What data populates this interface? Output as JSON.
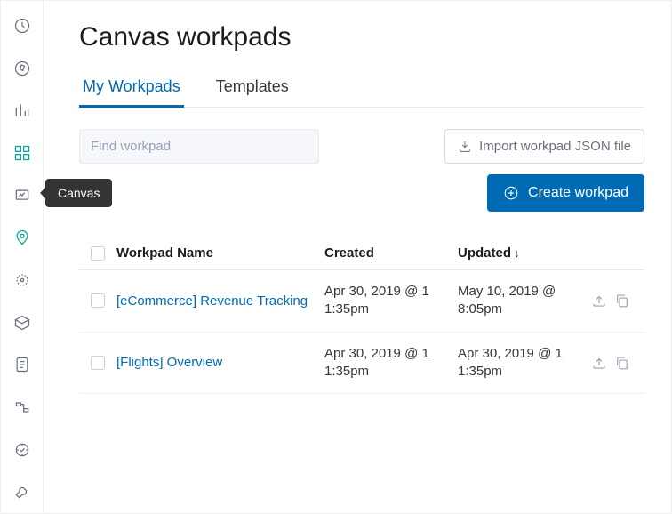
{
  "sidebar": {
    "tooltip": "Canvas",
    "items": [
      {
        "name": "clock-icon"
      },
      {
        "name": "compass-icon"
      },
      {
        "name": "bar-chart-icon"
      },
      {
        "name": "tiles-icon"
      },
      {
        "name": "canvas-icon"
      },
      {
        "name": "map-pin-icon"
      },
      {
        "name": "crosshair-icon"
      },
      {
        "name": "package-icon"
      },
      {
        "name": "scroll-icon"
      },
      {
        "name": "pipeline-icon"
      },
      {
        "name": "target-icon"
      },
      {
        "name": "wrench-icon"
      }
    ]
  },
  "page": {
    "title": "Canvas workpads"
  },
  "tabs": [
    {
      "label": "My Workpads",
      "active": true
    },
    {
      "label": "Templates",
      "active": false
    }
  ],
  "search": {
    "placeholder": "Find workpad"
  },
  "buttons": {
    "import": "Import workpad JSON file",
    "create": "Create workpad"
  },
  "table": {
    "columns": {
      "name": "Workpad Name",
      "created": "Created",
      "updated": "Updated"
    },
    "sort_indicator": "↓",
    "rows": [
      {
        "name": "[eCommerce] Revenue Tracking",
        "created_line1": "Apr 30, 2019 @ 1",
        "created_line2": "1:35pm",
        "updated_line1": "May 10, 2019 @",
        "updated_line2": "8:05pm"
      },
      {
        "name": "[Flights] Overview",
        "created_line1": "Apr 30, 2019 @ 1",
        "created_line2": "1:35pm",
        "updated_line1": "Apr 30, 2019 @ 1",
        "updated_line2": "1:35pm"
      }
    ]
  }
}
